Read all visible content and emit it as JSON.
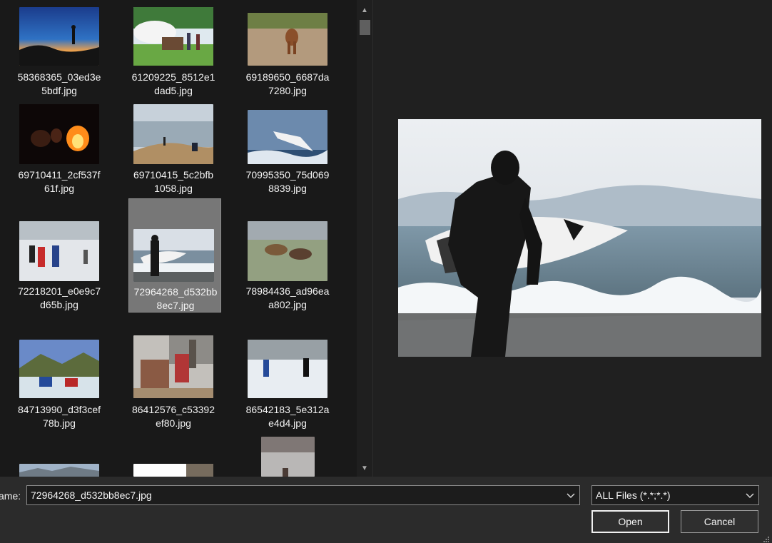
{
  "files": [
    {
      "line1": "58368365_03ed3e",
      "line2": "5bdf.jpg"
    },
    {
      "line1": "61209225_8512e1",
      "line2": "dad5.jpg"
    },
    {
      "line1": "69189650_6687da",
      "line2": "7280.jpg"
    },
    {
      "line1": "69710411_2cf537f",
      "line2": "61f.jpg"
    },
    {
      "line1": "69710415_5c2bfb",
      "line2": "1058.jpg"
    },
    {
      "line1": "70995350_75d069",
      "line2": "8839.jpg"
    },
    {
      "line1": "72218201_e0e9c7",
      "line2": "d65b.jpg"
    },
    {
      "line1": "72964268_d532bb",
      "line2": "8ec7.jpg"
    },
    {
      "line1": "78984436_ad96ea",
      "line2": "a802.jpg"
    },
    {
      "line1": "84713990_d3f3cef",
      "line2": "78b.jpg"
    },
    {
      "line1": "86412576_c53392",
      "line2": "ef80.jpg"
    },
    {
      "line1": "86542183_5e312a",
      "line2": "e4d4.jpg"
    }
  ],
  "footer": {
    "file_name_label": "ame:",
    "file_name_value": "72964268_d532bb8ec7.jpg",
    "file_type_value": "ALL Files (*.*;*.*)",
    "open_label": "Open",
    "cancel_label": "Cancel"
  },
  "scrollbar": {
    "up_glyph": "▲",
    "down_glyph": "▼"
  },
  "colors": {
    "selection": "#777777",
    "pane": "#191919",
    "footer": "#2b2b2b"
  },
  "icons": {
    "dropdown": "chevron-down-icon",
    "resize": "resize-grip-icon"
  }
}
